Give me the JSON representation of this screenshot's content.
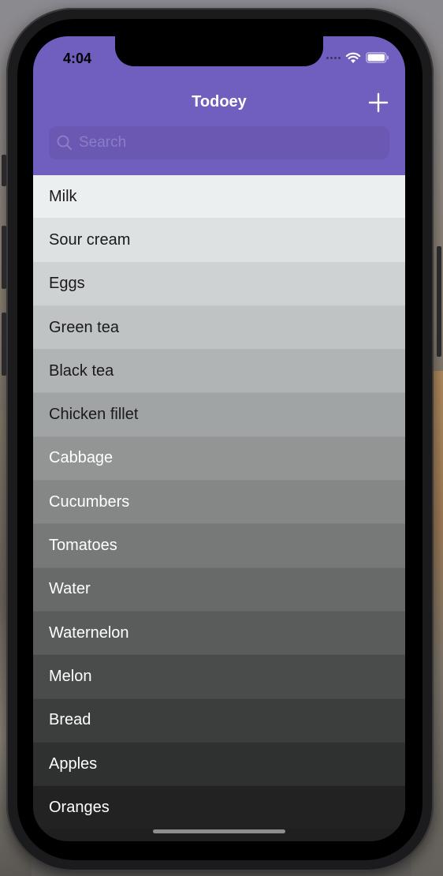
{
  "status_bar": {
    "time": "4:04"
  },
  "nav": {
    "title": "Todoey",
    "add_icon": "plus-icon"
  },
  "search": {
    "placeholder": "Search",
    "value": ""
  },
  "items": [
    {
      "label": "Milk",
      "bg": "#ebeff0",
      "fg": "#1a1a1a"
    },
    {
      "label": "Sour cream",
      "bg": "#dde1e2",
      "fg": "#1a1a1a"
    },
    {
      "label": "Eggs",
      "bg": "#cfd2d3",
      "fg": "#1a1a1a"
    },
    {
      "label": "Green tea",
      "bg": "#c0c3c4",
      "fg": "#1a1a1a"
    },
    {
      "label": "Black tea",
      "bg": "#b1b4b4",
      "fg": "#1a1a1a"
    },
    {
      "label": "Chicken fillet",
      "bg": "#a1a4a4",
      "fg": "#1a1a1a"
    },
    {
      "label": "Cabbage",
      "bg": "#939595",
      "fg": "#ffffff"
    },
    {
      "label": "Cucumbers",
      "bg": "#858787",
      "fg": "#ffffff"
    },
    {
      "label": "Tomatoes",
      "bg": "#777979",
      "fg": "#ffffff"
    },
    {
      "label": "Water",
      "bg": "#686a6a",
      "fg": "#ffffff"
    },
    {
      "label": "Waternelon",
      "bg": "#5a5c5c",
      "fg": "#ffffff"
    },
    {
      "label": "Melon",
      "bg": "#4a4c4c",
      "fg": "#ffffff"
    },
    {
      "label": "Bread",
      "bg": "#3c3e3e",
      "fg": "#ffffff"
    },
    {
      "label": "Apples",
      "bg": "#2f3030",
      "fg": "#ffffff"
    },
    {
      "label": "Oranges",
      "bg": "#222222",
      "fg": "#ffffff"
    }
  ],
  "colors": {
    "header": "#715fc0",
    "search_field": "#6a58b3"
  }
}
